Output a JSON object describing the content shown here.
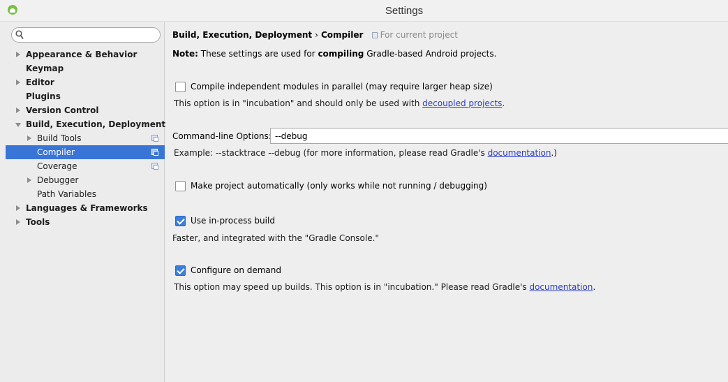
{
  "window": {
    "title": "Settings"
  },
  "search": {
    "value": "",
    "placeholder": ""
  },
  "sidebar": {
    "items": [
      {
        "label": "Appearance & Behavior"
      },
      {
        "label": "Keymap"
      },
      {
        "label": "Editor"
      },
      {
        "label": "Plugins"
      },
      {
        "label": "Version Control"
      },
      {
        "label": "Build, Execution, Deployment"
      },
      {
        "label": "Build Tools"
      },
      {
        "label": "Compiler"
      },
      {
        "label": "Coverage"
      },
      {
        "label": "Debugger"
      },
      {
        "label": "Path Variables"
      },
      {
        "label": "Languages & Frameworks"
      },
      {
        "label": "Tools"
      }
    ],
    "selected": "Compiler"
  },
  "breadcrumb": {
    "parent": "Build, Execution, Deployment",
    "separator": "›",
    "current": "Compiler",
    "scope": "For current project"
  },
  "note": {
    "prefix": "Note:",
    "text_before": " These settings are used for ",
    "emphasis": "compiling",
    "text_after": " Gradle-based Android projects."
  },
  "options": {
    "parallel": {
      "label": "Compile independent modules in parallel (may require larger heap size)",
      "checked": false,
      "desc_before": "This option is in \"incubation\" and should only be used with ",
      "desc_link": "decoupled projects",
      "desc_after": "."
    },
    "command_line": {
      "label": "Command-line Options:",
      "value": "--debug",
      "example_before": "Example: --stacktrace --debug (for more information, please read Gradle's ",
      "example_link": "documentation",
      "example_after": ".)"
    },
    "make_auto": {
      "label": "Make project automatically (only works while not running / debugging)",
      "checked": false
    },
    "in_process": {
      "label": "Use in-process build",
      "checked": true,
      "desc": "Faster, and integrated with the \"Gradle Console.\""
    },
    "on_demand": {
      "label": "Configure on demand",
      "checked": true,
      "desc_before": "This option may speed up builds. This option is in \"incubation.\" Please read Gradle's ",
      "desc_link": "documentation",
      "desc_after": "."
    }
  },
  "colors": {
    "selection": "#3875d6",
    "link": "#2a3cc7",
    "checkbox_checked": "#3d7fd8"
  }
}
